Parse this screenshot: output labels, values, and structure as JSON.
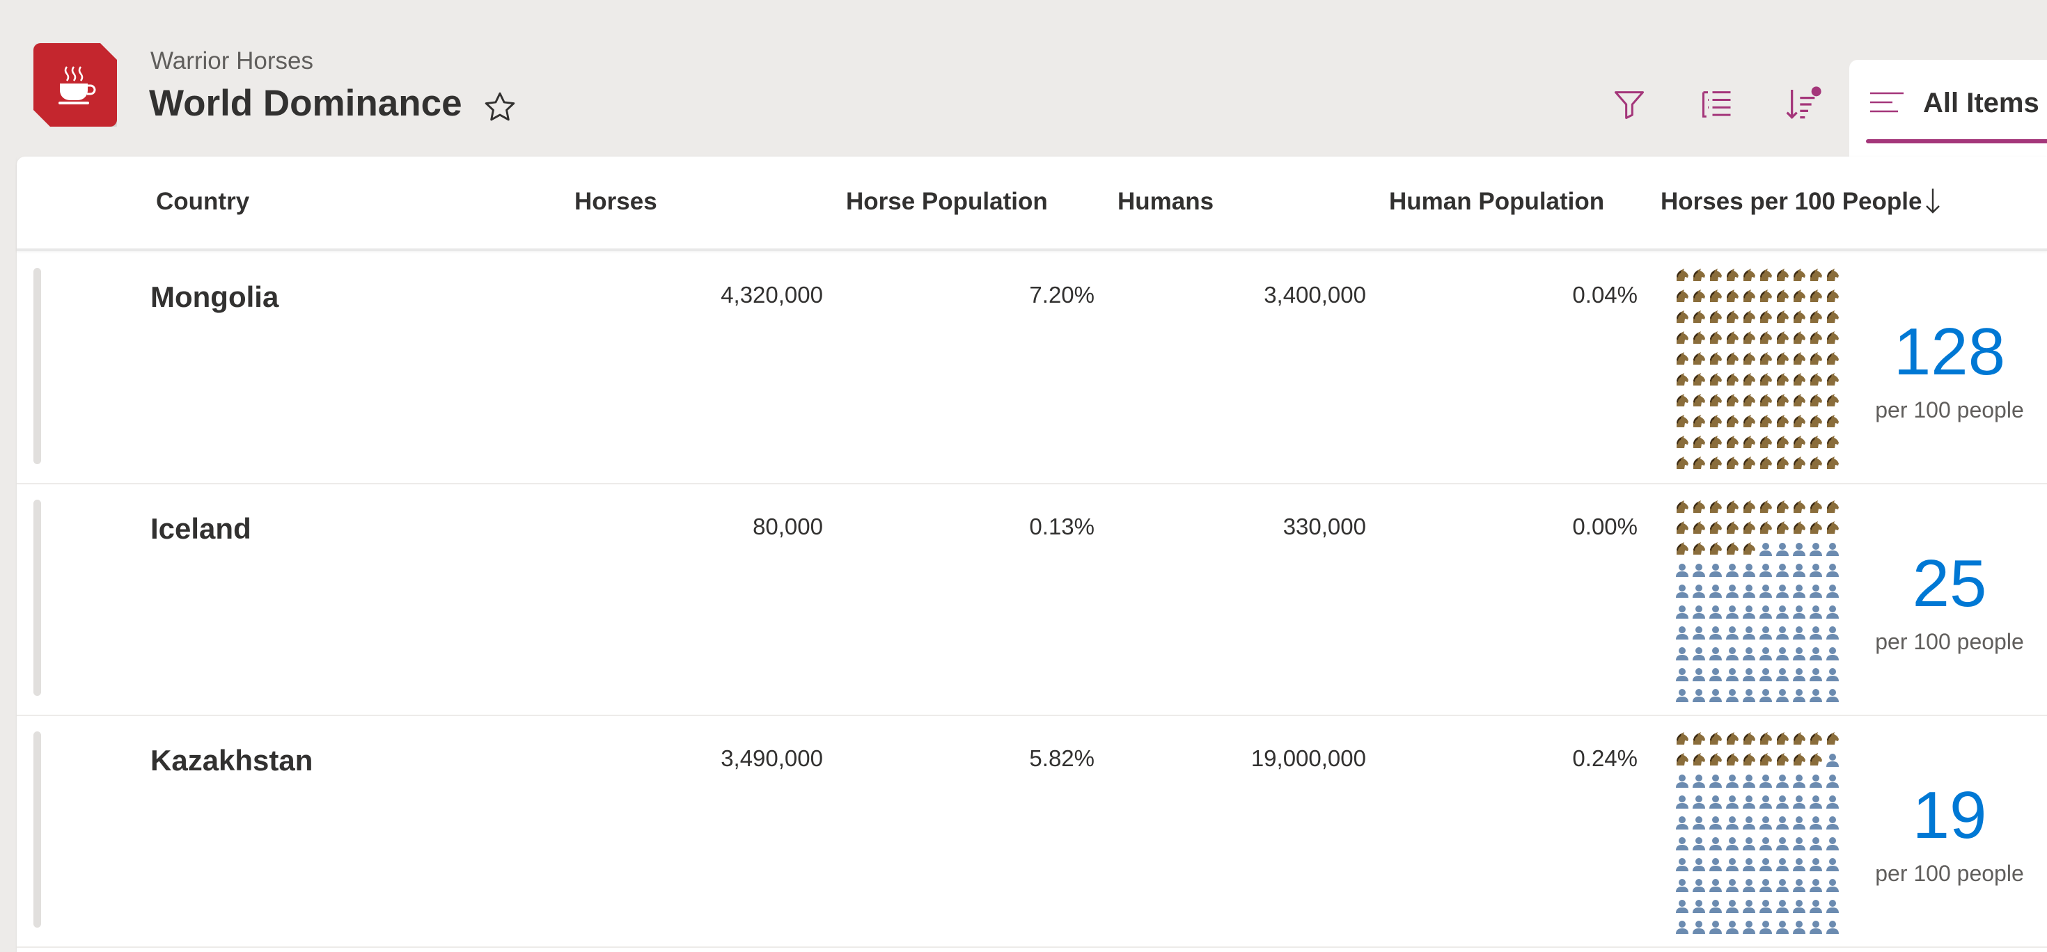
{
  "header": {
    "site_name": "Warrior Horses",
    "list_title": "World Dominance",
    "view_tab": "All Items",
    "logo_icon": "coffee-cup-icon",
    "accent_color": "#a4367a",
    "logo_color": "#c4262e"
  },
  "columns": [
    "Country",
    "Horses",
    "Horse Population",
    "Humans",
    "Human Population",
    "Horses per 100 People"
  ],
  "rows": [
    {
      "country": "Mongolia",
      "horses": "4,320,000",
      "horse_pop": "7.20%",
      "humans": "3,400,000",
      "human_pop": "0.04%",
      "ratio": "128",
      "ratio_label": "per 100 people",
      "horse_icons": 100
    },
    {
      "country": "Iceland",
      "horses": "80,000",
      "horse_pop": "0.13%",
      "humans": "330,000",
      "human_pop": "0.00%",
      "ratio": "25",
      "ratio_label": "per 100 people",
      "horse_icons": 25
    },
    {
      "country": "Kazakhstan",
      "horses": "3,490,000",
      "horse_pop": "5.82%",
      "humans": "19,000,000",
      "human_pop": "0.24%",
      "ratio": "19",
      "ratio_label": "per 100 people",
      "horse_icons": 19
    }
  ],
  "colors": {
    "ratio_blue": "#0078d4",
    "horse_icon": "#8a6d3b",
    "person_icon": "#6b8bb0"
  }
}
